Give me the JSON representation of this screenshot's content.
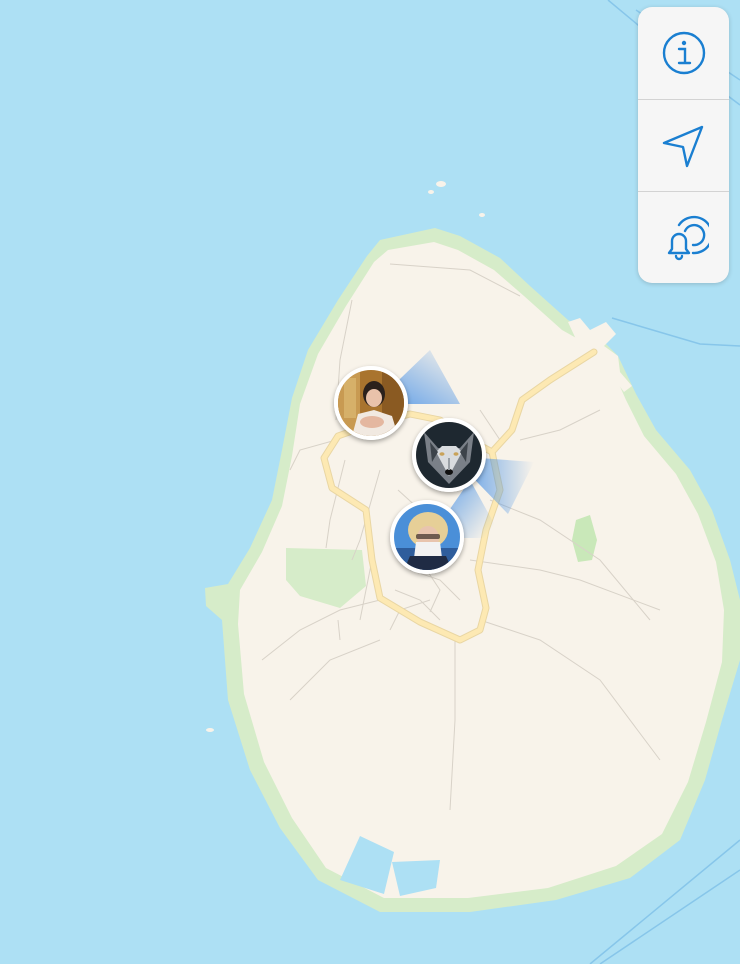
{
  "map": {
    "colors": {
      "water": "#ade0f4",
      "land": "#f8f3ea",
      "coast_vegetation": "#d6ecc9",
      "park": "#c9e8b9",
      "main_road": "#fde9b3",
      "minor_road": "#d8d2c8",
      "ferry_route": "#87c6ea",
      "heading_cone": "#3f8ce6"
    },
    "features": {
      "island": "island",
      "ponds": "pond",
      "park": "park",
      "ring_road": "main-road",
      "harbor_pier": "harbor-pier",
      "ferry_routes": "ferry-route"
    }
  },
  "controls": [
    {
      "id": "info",
      "icon": "info-icon",
      "color": "#1a7fd1"
    },
    {
      "id": "locate",
      "icon": "location-arrow-icon",
      "color": "#1a7fd1"
    },
    {
      "id": "notify",
      "icon": "bell-icon",
      "color": "#1a7fd1"
    }
  ],
  "people": [
    {
      "id": "person-1",
      "photo": "portrait-indoor",
      "has_heading": true
    },
    {
      "id": "person-2",
      "photo": "wolf",
      "has_heading": true
    },
    {
      "id": "person-3",
      "photo": "portrait-outdoor",
      "has_heading": true
    }
  ]
}
